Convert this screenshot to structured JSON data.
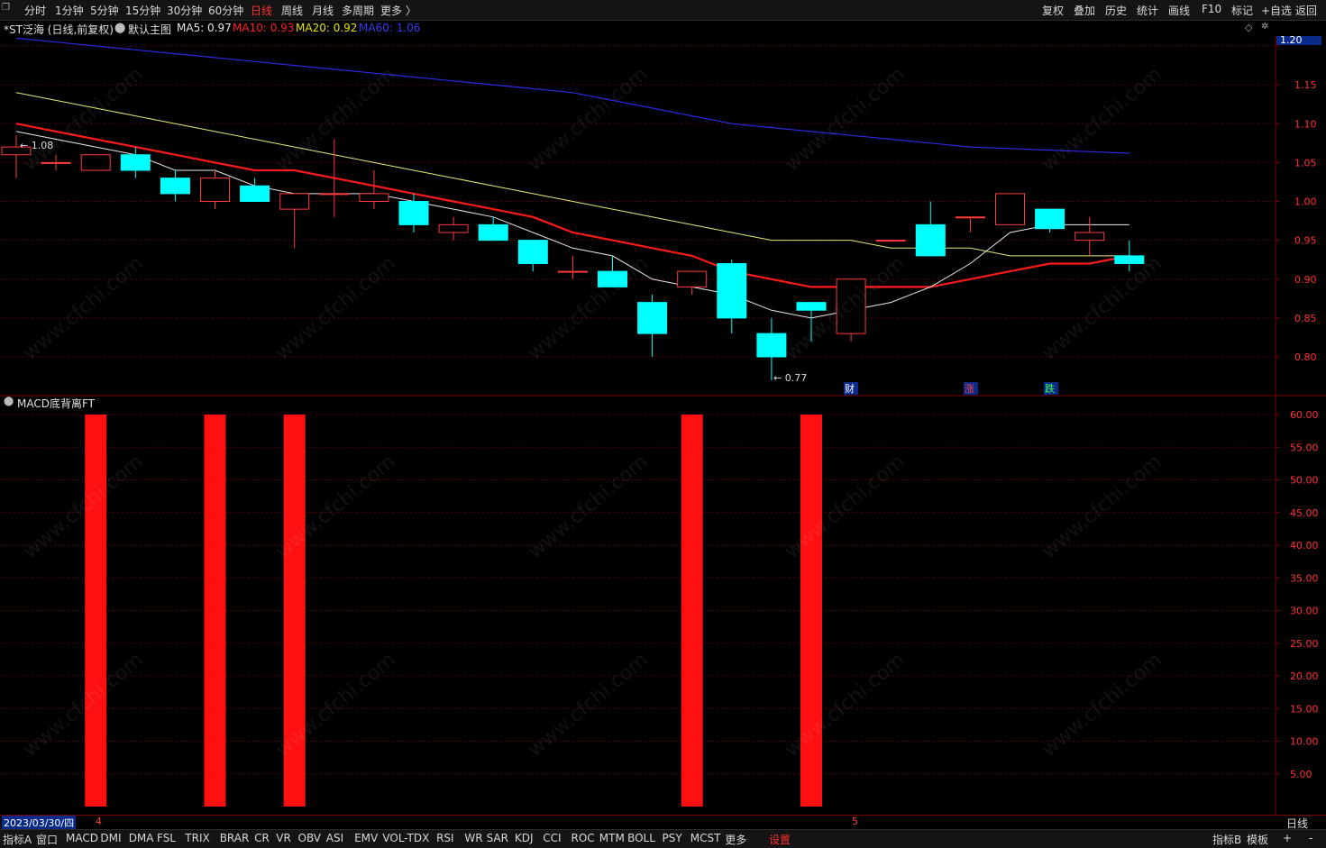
{
  "toolbar": {
    "periods": [
      "分时",
      "1分钟",
      "5分钟",
      "15分钟",
      "30分钟",
      "60分钟",
      "日线",
      "周线",
      "月线",
      "多周期",
      "更多 〉"
    ],
    "active_period": "日线",
    "right_items": [
      "复权",
      "叠加",
      "历史",
      "统计",
      "画线",
      "F10",
      "标记",
      "+自选",
      "返回"
    ]
  },
  "info": {
    "title": "*ST泛海 (日线,前复权)",
    "template": "默认主图",
    "ma5": "MA5: 0.97",
    "ma10": "MA10: 0.93",
    "ma20": "MA20: 0.92",
    "ma60": "MA60: 1.06"
  },
  "colors": {
    "up": "#ff3b3b",
    "down": "#00ffff",
    "ma5": "#e8e8e8",
    "ma10": "#ff1a1a",
    "ma20": "#e6e67a",
    "ma60": "#2a2ae0",
    "grid": "#5a0000"
  },
  "price_axis": {
    "current_price": "1.20",
    "ticks": [
      "1.20",
      "1.15",
      "1.10",
      "1.05",
      "1.00",
      "0.95",
      "0.90",
      "0.85",
      "0.80"
    ]
  },
  "annotations": {
    "high": "1.08",
    "low": "0.77",
    "markers": [
      "财",
      "涨",
      "跌"
    ]
  },
  "indicator": {
    "title": "MACD底背离FT",
    "ticks": [
      "60.00",
      "55.00",
      "50.00",
      "45.00",
      "40.00",
      "35.00",
      "30.00",
      "25.00",
      "20.00",
      "15.00",
      "10.00",
      "5.00"
    ]
  },
  "chart_data": [
    {
      "type": "candlestick",
      "title": "*ST泛海 (日线,前复权)",
      "ylim": [
        0.75,
        1.21
      ],
      "candles": [
        {
          "o": 1.06,
          "h": 1.085,
          "l": 1.03,
          "c": 1.07
        },
        {
          "o": 1.05,
          "h": 1.06,
          "l": 1.04,
          "c": 1.05
        },
        {
          "o": 1.04,
          "h": 1.06,
          "l": 1.04,
          "c": 1.06
        },
        {
          "o": 1.06,
          "h": 1.07,
          "l": 1.03,
          "c": 1.04
        },
        {
          "o": 1.03,
          "h": 1.04,
          "l": 1.0,
          "c": 1.01
        },
        {
          "o": 1.0,
          "h": 1.04,
          "l": 0.99,
          "c": 1.03
        },
        {
          "o": 1.02,
          "h": 1.03,
          "l": 1.0,
          "c": 1.0
        },
        {
          "o": 0.99,
          "h": 1.01,
          "l": 0.94,
          "c": 1.01
        },
        {
          "o": 1.01,
          "h": 1.08,
          "l": 0.98,
          "c": 1.01
        },
        {
          "o": 1.0,
          "h": 1.04,
          "l": 0.99,
          "c": 1.01
        },
        {
          "o": 1.0,
          "h": 1.01,
          "l": 0.96,
          "c": 0.97
        },
        {
          "o": 0.96,
          "h": 0.98,
          "l": 0.95,
          "c": 0.97
        },
        {
          "o": 0.97,
          "h": 0.98,
          "l": 0.95,
          "c": 0.95
        },
        {
          "o": 0.95,
          "h": 0.95,
          "l": 0.91,
          "c": 0.92
        },
        {
          "o": 0.91,
          "h": 0.93,
          "l": 0.9,
          "c": 0.91
        },
        {
          "o": 0.91,
          "h": 0.93,
          "l": 0.89,
          "c": 0.89
        },
        {
          "o": 0.87,
          "h": 0.88,
          "l": 0.8,
          "c": 0.83
        },
        {
          "o": 0.89,
          "h": 0.91,
          "l": 0.88,
          "c": 0.91
        },
        {
          "o": 0.92,
          "h": 0.925,
          "l": 0.83,
          "c": 0.85
        },
        {
          "o": 0.83,
          "h": 0.85,
          "l": 0.77,
          "c": 0.8
        },
        {
          "o": 0.87,
          "h": 0.87,
          "l": 0.82,
          "c": 0.86
        },
        {
          "o": 0.83,
          "h": 0.9,
          "l": 0.82,
          "c": 0.9
        },
        {
          "o": 0.95,
          "h": 0.95,
          "l": 0.95,
          "c": 0.95
        },
        {
          "o": 0.97,
          "h": 1.0,
          "l": 0.93,
          "c": 0.93
        },
        {
          "o": 0.98,
          "h": 0.98,
          "l": 0.96,
          "c": 0.98
        },
        {
          "o": 0.97,
          "h": 1.01,
          "l": 0.97,
          "c": 1.01
        },
        {
          "o": 0.99,
          "h": 0.99,
          "l": 0.96,
          "c": 0.965
        },
        {
          "o": 0.95,
          "h": 0.98,
          "l": 0.93,
          "c": 0.96
        },
        {
          "o": 0.93,
          "h": 0.95,
          "l": 0.91,
          "c": 0.92
        }
      ],
      "ma5": [
        1.09,
        1.08,
        1.07,
        1.06,
        1.04,
        1.04,
        1.02,
        1.01,
        1.01,
        1.01,
        1.0,
        0.99,
        0.98,
        0.96,
        0.94,
        0.93,
        0.9,
        0.89,
        0.88,
        0.86,
        0.85,
        0.86,
        0.87,
        0.89,
        0.92,
        0.96,
        0.97,
        0.97,
        0.97
      ],
      "ma10": [
        1.1,
        1.09,
        1.08,
        1.07,
        1.06,
        1.05,
        1.04,
        1.04,
        1.03,
        1.02,
        1.01,
        1.0,
        0.99,
        0.98,
        0.96,
        0.95,
        0.94,
        0.93,
        0.91,
        0.9,
        0.89,
        0.89,
        0.89,
        0.89,
        0.9,
        0.91,
        0.92,
        0.92,
        0.93
      ],
      "ma20": [
        1.14,
        1.13,
        1.12,
        1.11,
        1.1,
        1.09,
        1.08,
        1.07,
        1.06,
        1.05,
        1.04,
        1.03,
        1.02,
        1.01,
        1.0,
        0.99,
        0.98,
        0.97,
        0.96,
        0.95,
        0.95,
        0.95,
        0.94,
        0.94,
        0.94,
        0.93,
        0.93,
        0.93,
        0.93
      ],
      "ma60": [
        1.21,
        1.205,
        1.2,
        1.195,
        1.19,
        1.185,
        1.18,
        1.175,
        1.17,
        1.165,
        1.16,
        1.155,
        1.15,
        1.145,
        1.14,
        1.13,
        1.12,
        1.11,
        1.1,
        1.095,
        1.09,
        1.085,
        1.08,
        1.075,
        1.07,
        1.068,
        1.066,
        1.064,
        1.062
      ]
    },
    {
      "type": "bar",
      "title": "MACD底背离FT",
      "ylim": [
        0,
        61
      ],
      "bar_indices": [
        2,
        5,
        7,
        17,
        20
      ],
      "values": [
        60,
        60,
        60,
        60,
        60
      ]
    }
  ],
  "datebar": {
    "date": "2023/03/30/四",
    "month_a": "4",
    "month_b": "5",
    "period": "日线"
  },
  "tabs": {
    "left_label": "指标A",
    "window": "窗口",
    "items": [
      "MACD",
      "DMI",
      "DMA",
      "FSL",
      "TRIX",
      "BRAR",
      "CR",
      "VR",
      "OBV",
      "ASI",
      "EMV",
      "VOL-TDX",
      "RSI",
      "WR",
      "SAR",
      "KDJ",
      "CCI",
      "ROC",
      "MTM",
      "BOLL",
      "PSY",
      "MCST",
      "更多"
    ],
    "settings": "设置",
    "right": [
      "指标B",
      "模板",
      "+",
      "-"
    ]
  },
  "watermark": "www.cfchi.com"
}
